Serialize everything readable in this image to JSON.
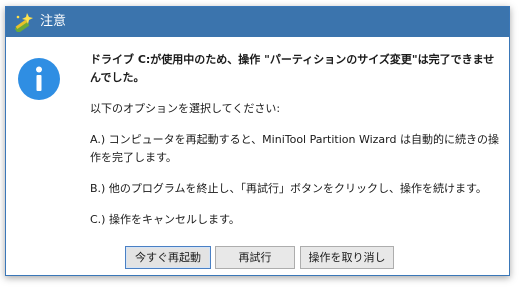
{
  "window": {
    "title": "注意",
    "app_icon": "minitool-wand-icon",
    "info_icon": "info-circle-icon",
    "title_bar_color": "#3b74ad",
    "info_icon_color": "#2f8ee3"
  },
  "message": {
    "heading": "ドライブ C:が使用中のため、操作 \"パーティションのサイズ変更\"は完了できませんでした。",
    "prompt": "以下のオプションを選択してください:",
    "option_a": "A.) コンピュータを再起動すると、MiniTool Partition Wizard は自動的に続きの操作を完了します。",
    "option_b": "B.) 他のプログラムを終止し、「再試行」ボタンをクリックし、操作を続けます。",
    "option_c": "C.) 操作をキャンセルします。"
  },
  "buttons": {
    "restart": "今すぐ再起動",
    "retry": "再試行",
    "cancel": "操作を取り消し"
  }
}
